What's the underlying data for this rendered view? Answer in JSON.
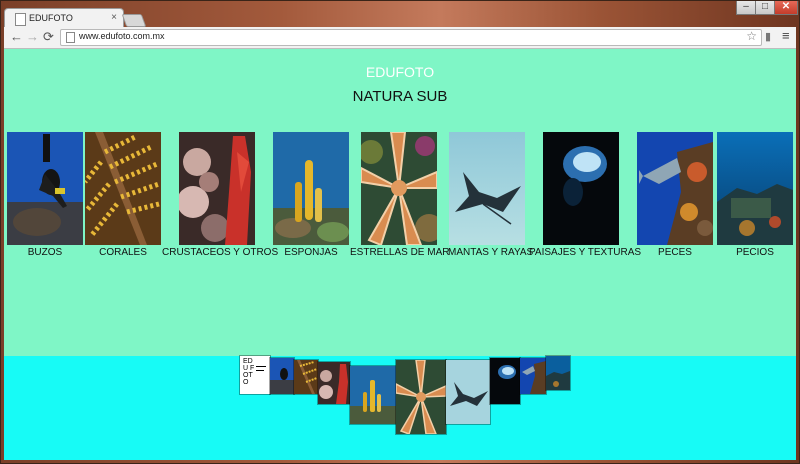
{
  "browser": {
    "tab_title": "EDUFOTO",
    "tab_close": "×",
    "url": "www.edufoto.com.mx",
    "window_min": "–",
    "window_max": "□",
    "window_close": "✕",
    "back": "←",
    "forward": "→",
    "reload": "⟳",
    "star": "☆",
    "menu": "≡"
  },
  "page": {
    "site_title": "EDUFOTO",
    "subtitle": "NATURA SUB",
    "categories": [
      {
        "label": "BUZOS",
        "icon": "diver-photo"
      },
      {
        "label": "CORALES",
        "icon": "coral-photo"
      },
      {
        "label": "CRUSTACEOS Y OTROS",
        "icon": "crustacean-photo"
      },
      {
        "label": "ESPONJAS",
        "icon": "sponge-photo"
      },
      {
        "label": "ESTRELLAS DE MAR",
        "icon": "starfish-photo"
      },
      {
        "label": "MANTAS Y RAYAS",
        "icon": "ray-photo"
      },
      {
        "label": "PAISAJES Y TEXTURAS",
        "icon": "cave-photo"
      },
      {
        "label": "PECES",
        "icon": "fish-photo"
      },
      {
        "label": "PECIOS",
        "icon": "wreck-photo"
      }
    ],
    "thumb_logo": "EDU FOTO"
  },
  "colors": {
    "page_bg": "#7ff6c6",
    "footer_bg": "#17fbf6"
  }
}
